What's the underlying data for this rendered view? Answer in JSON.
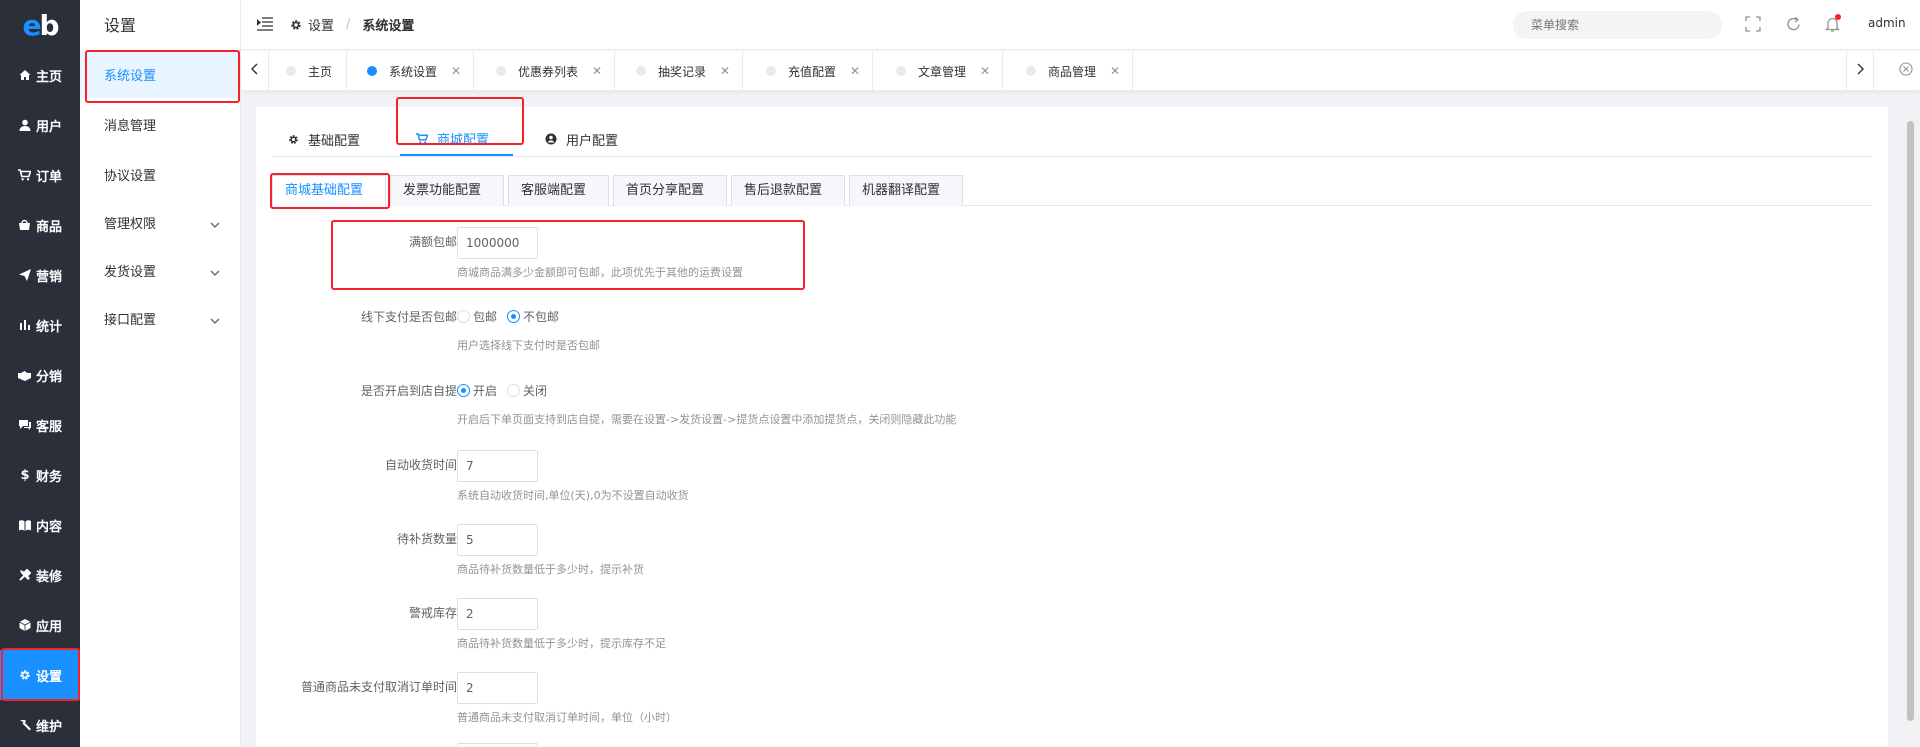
{
  "logo": {
    "text_e": "e",
    "text_b": "b"
  },
  "nav1": [
    {
      "label": "主页",
      "icon": "home-icon"
    },
    {
      "label": "用户",
      "icon": "user-icon"
    },
    {
      "label": "订单",
      "icon": "cart-icon"
    },
    {
      "label": "商品",
      "icon": "shop-icon"
    },
    {
      "label": "营销",
      "icon": "paper-plane-icon"
    },
    {
      "label": "统计",
      "icon": "bar-chart-icon"
    },
    {
      "label": "分销",
      "icon": "handshake-icon"
    },
    {
      "label": "客服",
      "icon": "chat-icon"
    },
    {
      "label": "财务",
      "icon": "dollar-icon"
    },
    {
      "label": "内容",
      "icon": "book-icon"
    },
    {
      "label": "装修",
      "icon": "tools-icon"
    },
    {
      "label": "应用",
      "icon": "cube-icon"
    },
    {
      "label": "设置",
      "icon": "gear-icon",
      "active": true
    },
    {
      "label": "维护",
      "icon": "hammer-icon"
    }
  ],
  "side2": {
    "title": "设置",
    "items": [
      {
        "label": "系统设置",
        "active": true
      },
      {
        "label": "消息管理"
      },
      {
        "label": "协议设置"
      },
      {
        "label": "管理权限",
        "expandable": true
      },
      {
        "label": "发货设置",
        "expandable": true
      },
      {
        "label": "接口配置",
        "expandable": true
      }
    ]
  },
  "header": {
    "breadcrumb": [
      "设置",
      "系统设置"
    ],
    "search_placeholder": "菜单搜索",
    "user": "admin"
  },
  "tags": [
    {
      "label": "主页",
      "closable": false
    },
    {
      "label": "系统设置",
      "closable": true,
      "active": true
    },
    {
      "label": "优惠券列表",
      "closable": true
    },
    {
      "label": "抽奖记录",
      "closable": true
    },
    {
      "label": "充值配置",
      "closable": true
    },
    {
      "label": "文章管理",
      "closable": true
    },
    {
      "label": "商品管理",
      "closable": true
    }
  ],
  "primary_tabs": [
    {
      "label": "基础配置",
      "icon": "gear-icon"
    },
    {
      "label": "商城配置",
      "icon": "cart-icon",
      "active": true
    },
    {
      "label": "用户配置",
      "icon": "user-circle-icon"
    }
  ],
  "card_tabs": [
    {
      "label": "商城基础配置",
      "active": true
    },
    {
      "label": "发票功能配置"
    },
    {
      "label": "客服端配置"
    },
    {
      "label": "首页分享配置"
    },
    {
      "label": "售后退款配置"
    },
    {
      "label": "机器翻译配置"
    }
  ],
  "form": {
    "free_shipping": {
      "label": "满额包邮",
      "value": "1000000",
      "help": "商城商品满多少金额即可包邮，此项优先于其他的运费设置"
    },
    "offline_pay": {
      "label": "线下支付是否包邮",
      "options": [
        "包邮",
        "不包邮"
      ],
      "selected": "不包邮",
      "help": "用户选择线下支付时是否包邮"
    },
    "store_pickup": {
      "label": "是否开启到店自提",
      "options": [
        "开启",
        "关闭"
      ],
      "selected": "开启",
      "help": "开启后下单页面支持到店自提，需要在设置->发货设置->提货点设置中添加提货点，关闭则隐藏此功能"
    },
    "auto_receive": {
      "label": "自动收货时间",
      "value": "7",
      "help": "系统自动收货时间,单位(天),0为不设置自动收货"
    },
    "restock": {
      "label": "待补货数量",
      "value": "5",
      "help": "商品待补货数量低于多少时，提示补货"
    },
    "stock_alert": {
      "label": "警戒库存",
      "value": "2",
      "help": "商品待补货数量低于多少时，提示库存不足"
    },
    "unpaid_cancel": {
      "label": "普通商品未支付取消订单时间",
      "value": "2",
      "help": "普通商品未支付取消订单时间，单位（小时）"
    }
  },
  "colors": {
    "accent": "#1890ff",
    "sidebar_bg": "#2b2f3a",
    "highlight": "#f5222d"
  }
}
